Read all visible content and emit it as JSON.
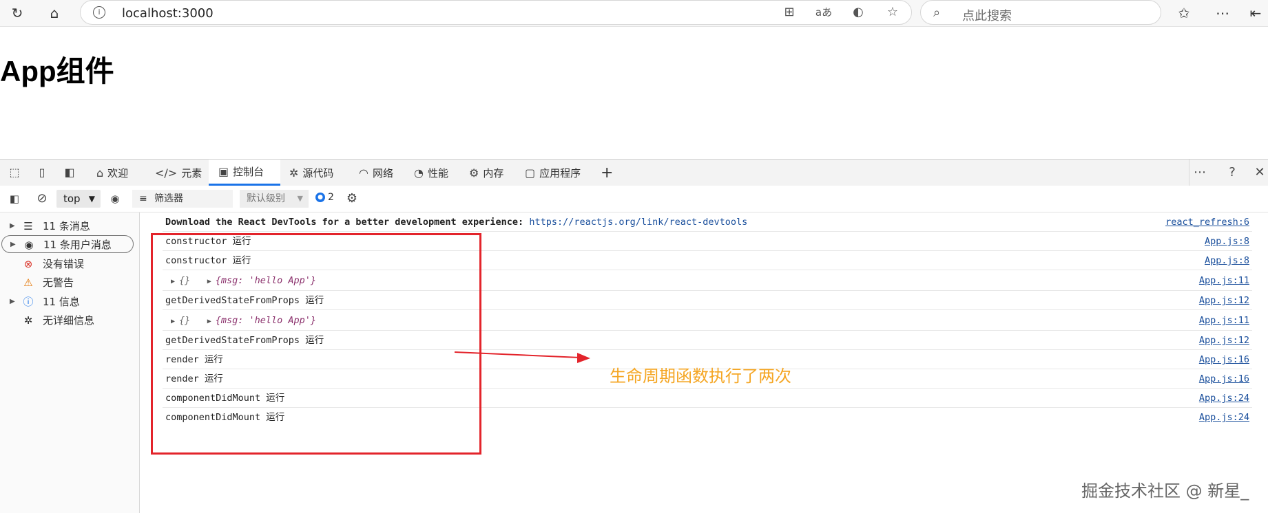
{
  "browser": {
    "url": "localhost:3000",
    "search_placeholder": "点此搜索",
    "addr_tools": [
      "split-screen-icon",
      "read-aloud-icon",
      "edge-icon",
      "favorite-star-icon"
    ]
  },
  "page": {
    "title": "App组件"
  },
  "devtools": {
    "tabs": [
      {
        "label": "欢迎",
        "icon": "home-icon"
      },
      {
        "label": "元素",
        "icon": "code-icon"
      },
      {
        "label": "控制台",
        "icon": "console-icon",
        "active": true
      },
      {
        "label": "源代码",
        "icon": "bug-icon"
      },
      {
        "label": "网络",
        "icon": "wifi-icon"
      },
      {
        "label": "性能",
        "icon": "gauge-icon"
      },
      {
        "label": "内存",
        "icon": "memory-icon"
      },
      {
        "label": "应用程序",
        "icon": "app-icon"
      }
    ],
    "toolbar": {
      "context": "top",
      "filter_placeholder": "筛选器",
      "level": "默认级别",
      "issues_count": "2"
    },
    "sidebar": [
      {
        "label": "11 条消息",
        "icon": "list-icon",
        "expandable": true
      },
      {
        "label": "11 条用户消息",
        "icon": "user-icon",
        "expandable": true,
        "selected": true
      },
      {
        "label": "没有错误",
        "icon": "error-icon",
        "expandable": false
      },
      {
        "label": "无警告",
        "icon": "warning-icon",
        "expandable": false
      },
      {
        "label": "11 信息",
        "icon": "info-icon",
        "expandable": true
      },
      {
        "label": "无详细信息",
        "icon": "bug-icon",
        "expandable": false
      }
    ],
    "console": {
      "banner": {
        "text": "Download the React DevTools for a better development experience: ",
        "link": "https://reactjs.org/link/react-devtools",
        "source": "react_refresh:6"
      },
      "rows": [
        {
          "msg": "constructor 运行",
          "source": "App.js:8"
        },
        {
          "msg": "constructor 运行",
          "source": "App.js:8"
        },
        {
          "obj1": "{}",
          "obj2": "{msg: 'hello App'}",
          "source": "App.js:11"
        },
        {
          "msg": "getDerivedStateFromProps 运行",
          "source": "App.js:12"
        },
        {
          "obj1": "{}",
          "obj2": "{msg: 'hello App'}",
          "source": "App.js:11"
        },
        {
          "msg": "getDerivedStateFromProps 运行",
          "source": "App.js:12"
        },
        {
          "msg": "render 运行",
          "source": "App.js:16"
        },
        {
          "msg": "render 运行",
          "source": "App.js:16"
        },
        {
          "msg": "componentDidMount 运行",
          "source": "App.js:24"
        },
        {
          "msg": "componentDidMount 运行",
          "source": "App.js:24"
        }
      ]
    }
  },
  "annotation": {
    "text": "生命周期函数执行了两次",
    "color": "#f5a623"
  },
  "watermark": "掘金技术社区 @ 新星_"
}
